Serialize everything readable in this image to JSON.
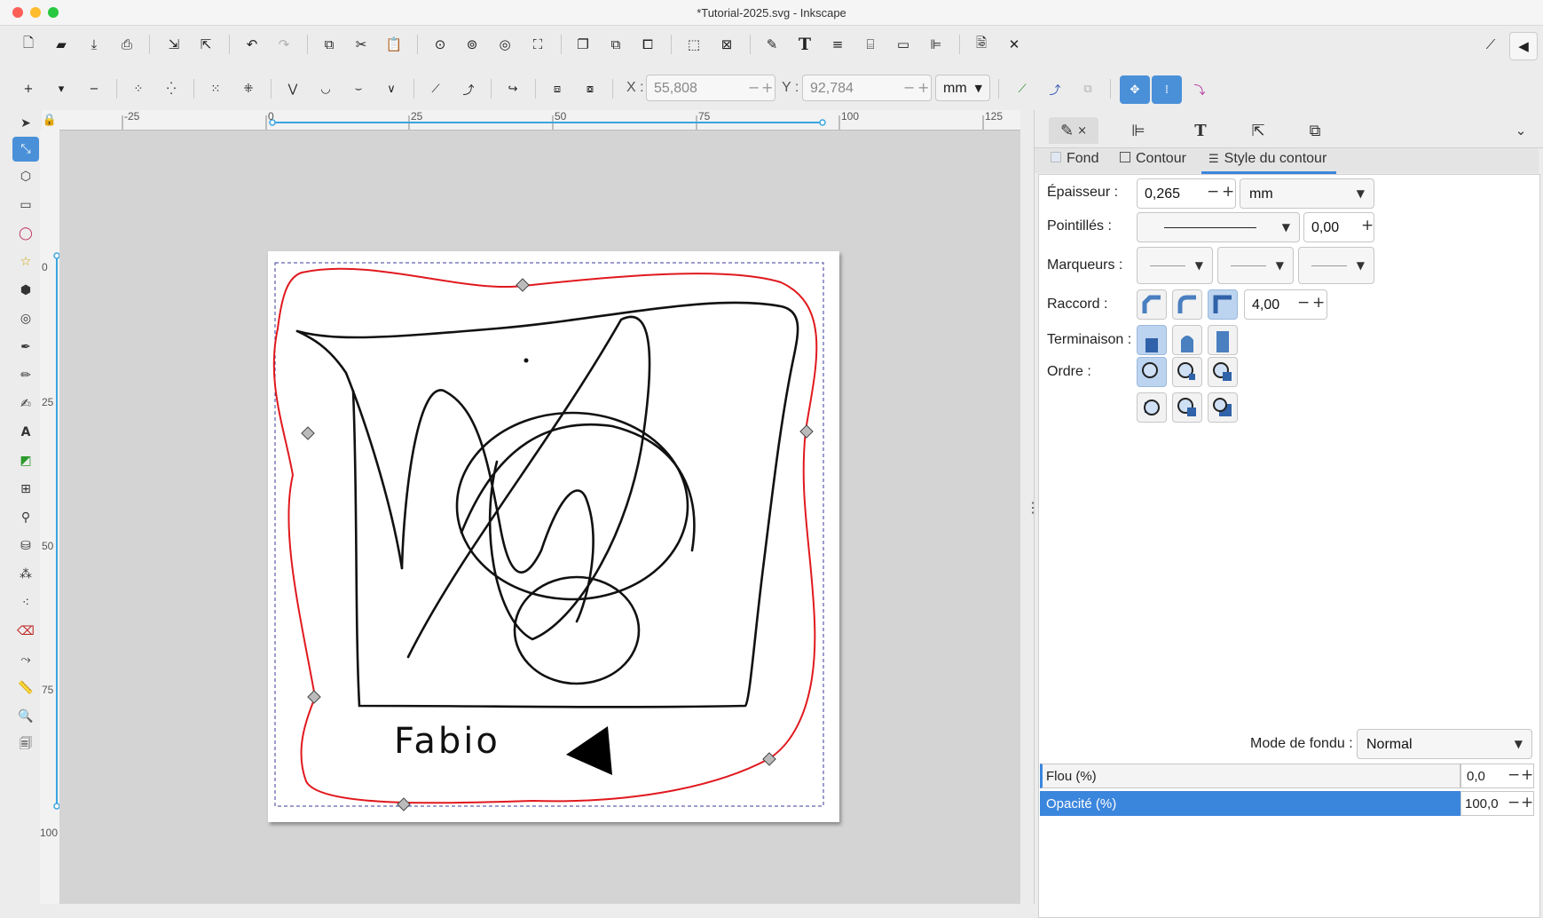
{
  "window": {
    "title": "*Tutorial-2025.svg - Inkscape"
  },
  "icons": {
    "new": "new-document-icon",
    "open": "open-icon",
    "save": "save-icon",
    "print": "print-icon",
    "import": "import-icon",
    "export": "export-icon",
    "undo": "undo-icon",
    "redo": "redo-icon",
    "copy": "copy-icon",
    "cut": "cut-icon",
    "paste": "paste-icon",
    "zoom_selection": "zoom-selection-icon",
    "zoom_drawing": "zoom-drawing-icon",
    "zoom_page": "zoom-page-icon",
    "zoom_width": "zoom-width-icon"
  },
  "node_toolbar": {
    "x_label": "X :",
    "x_value": "55,808",
    "y_label": "Y :",
    "y_value": "92,784",
    "unit": "mm"
  },
  "rulers": {
    "horizontal": [
      "-25",
      "0",
      "25",
      "50",
      "75",
      "100",
      "125"
    ],
    "vertical": [
      "0",
      "25",
      "50",
      "75",
      "100"
    ]
  },
  "canvas": {
    "text_object": "Fabio"
  },
  "dock": {
    "subtabs": {
      "fill": "Fond",
      "stroke": "Contour",
      "stroke_style": "Style du contour"
    },
    "epaisseur_label": "Épaisseur :",
    "epaisseur_value": "0,265",
    "epaisseur_unit": "mm",
    "pointilles_label": "Pointillés :",
    "pointilles_offset": "0,00",
    "marqueurs_label": "Marqueurs :",
    "raccord_label": "Raccord :",
    "raccord_value": "4,00",
    "terminaison_label": "Terminaison :",
    "ordre_label": "Ordre :",
    "blend_label": "Mode de fondu :",
    "blend_value": "Normal",
    "blur_label": "Flou (%)",
    "blur_value": "0,0",
    "opacity_label": "Opacité (%)",
    "opacity_value": "100,0"
  },
  "colors": {
    "accent": "#4a90d9",
    "path_red": "#e0191e",
    "opacity_bar": "#3b86dd"
  }
}
